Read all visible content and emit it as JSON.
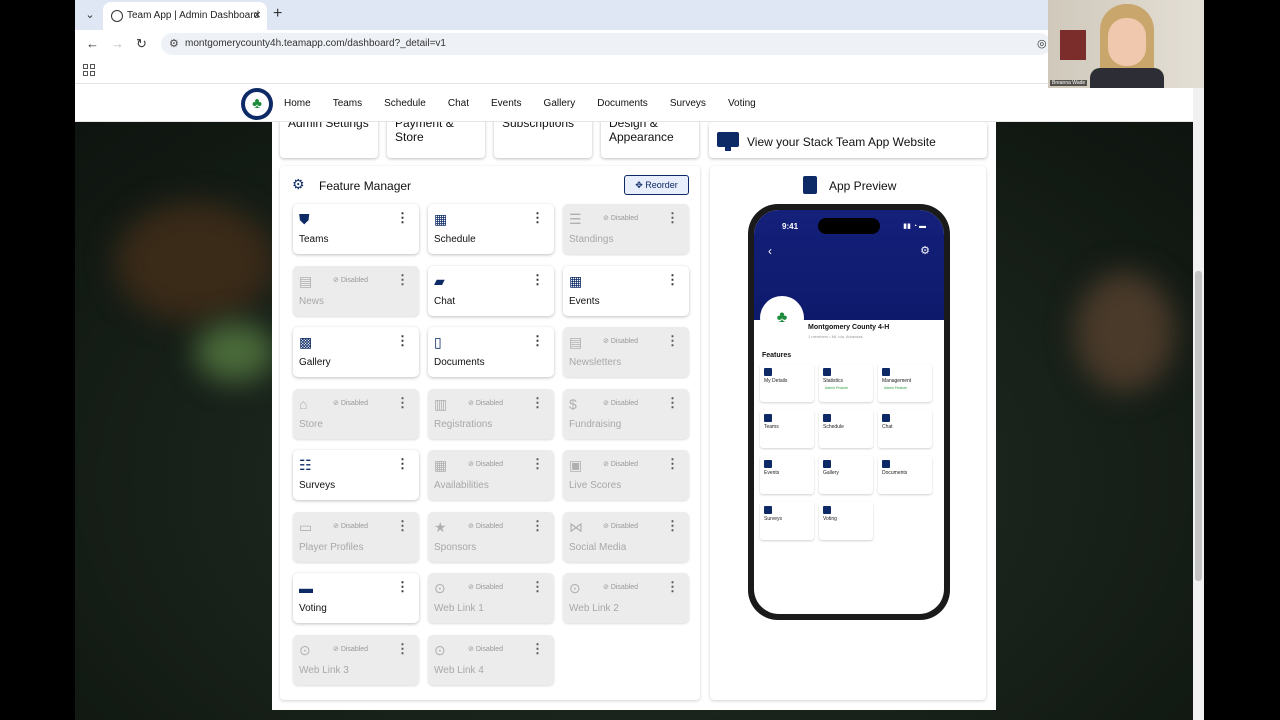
{
  "browser": {
    "tab_title": "Team App | Admin Dashboard",
    "url": "montgomerycounty4h.teamapp.com/dashboard?_detail=v1"
  },
  "nav": {
    "items": [
      "Home",
      "Teams",
      "Schedule",
      "Chat",
      "Events",
      "Gallery",
      "Documents",
      "Surveys",
      "Voting"
    ]
  },
  "settings_tiles": [
    {
      "label": "Admin Settings"
    },
    {
      "label": "Payment & Store"
    },
    {
      "label": "Subscriptions"
    },
    {
      "label": "Design & Appearance"
    }
  ],
  "view_site": {
    "label": "View your Stack Team App Website"
  },
  "feature_manager": {
    "title": "Feature Manager",
    "reorder_label": "Reorder",
    "disabled_label": "Disabled",
    "features": [
      {
        "name": "Teams",
        "enabled": true,
        "icon": "shield-icon"
      },
      {
        "name": "Schedule",
        "enabled": true,
        "icon": "calendar-icon"
      },
      {
        "name": "Standings",
        "enabled": false,
        "icon": "list-numbered-icon"
      },
      {
        "name": "News",
        "enabled": false,
        "icon": "newspaper-icon"
      },
      {
        "name": "Chat",
        "enabled": true,
        "icon": "chat-icon"
      },
      {
        "name": "Events",
        "enabled": true,
        "icon": "event-calendar-icon"
      },
      {
        "name": "Gallery",
        "enabled": true,
        "icon": "gallery-icon"
      },
      {
        "name": "Documents",
        "enabled": true,
        "icon": "document-icon"
      },
      {
        "name": "Newsletters",
        "enabled": false,
        "icon": "newsletter-icon"
      },
      {
        "name": "Store",
        "enabled": false,
        "icon": "store-icon"
      },
      {
        "name": "Registrations",
        "enabled": false,
        "icon": "clipboard-icon"
      },
      {
        "name": "Fundraising",
        "enabled": false,
        "icon": "fundraising-icon"
      },
      {
        "name": "Surveys",
        "enabled": true,
        "icon": "survey-icon"
      },
      {
        "name": "Availabilities",
        "enabled": false,
        "icon": "calendar-check-icon"
      },
      {
        "name": "Live Scores",
        "enabled": false,
        "icon": "scoreboard-icon"
      },
      {
        "name": "Player Profiles",
        "enabled": false,
        "icon": "profile-icon"
      },
      {
        "name": "Sponsors",
        "enabled": false,
        "icon": "star-icon"
      },
      {
        "name": "Social Media",
        "enabled": false,
        "icon": "share-icon"
      },
      {
        "name": "Voting",
        "enabled": true,
        "icon": "ballot-icon"
      },
      {
        "name": "Web Link 1",
        "enabled": false,
        "icon": "link-icon"
      },
      {
        "name": "Web Link 2",
        "enabled": false,
        "icon": "link-icon"
      },
      {
        "name": "Web Link 3",
        "enabled": false,
        "icon": "link-icon"
      },
      {
        "name": "Web Link 4",
        "enabled": false,
        "icon": "link-icon"
      }
    ]
  },
  "preview": {
    "title": "App Preview",
    "time": "9:41",
    "org_name": "Montgomery County 4-H",
    "org_sub": "1 members • Mt. Ida, Arkansas",
    "features_label": "Features",
    "admin_feature_label": "Admin Feature",
    "tiles": [
      {
        "name": "My Details",
        "admin": false
      },
      {
        "name": "Statistics",
        "admin": true
      },
      {
        "name": "Management",
        "admin": true
      },
      {
        "name": "Teams",
        "admin": false
      },
      {
        "name": "Schedule",
        "admin": false
      },
      {
        "name": "Chat",
        "admin": false
      },
      {
        "name": "Events",
        "admin": false
      },
      {
        "name": "Gallery",
        "admin": false
      },
      {
        "name": "Documents",
        "admin": false
      },
      {
        "name": "Surveys",
        "admin": false
      },
      {
        "name": "Voting",
        "admin": false
      }
    ]
  },
  "webcam": {
    "name": "Breanna Wade"
  },
  "colors": {
    "brand": "#0d2a66",
    "accent_green": "#1c8c3c"
  }
}
